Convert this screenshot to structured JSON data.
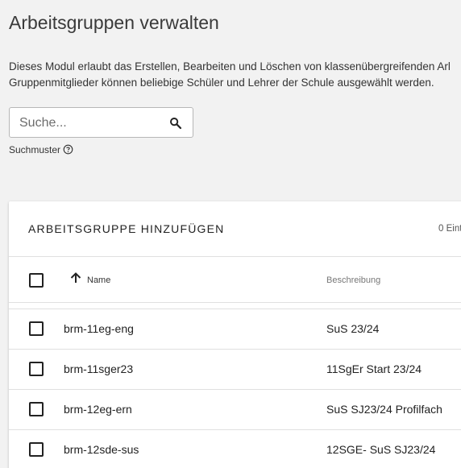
{
  "page": {
    "title": "Arbeitsgruppen verwalten",
    "description_line1": "Dieses Modul erlaubt das Erstellen, Bearbeiten und Löschen von klassenübergreifenden Arl",
    "description_line2": "Gruppenmitglieder können beliebige Schüler und Lehrer der Schule ausgewählt werden."
  },
  "search": {
    "placeholder": "Suche...",
    "value": "",
    "icon": "search-icon",
    "pattern_label": "Suchmuster",
    "help_icon": "help-circle-icon"
  },
  "card": {
    "title": "ARBEITSGRUPPE HINZUFÜGEN",
    "entries_label": "0 Eint"
  },
  "table": {
    "columns": {
      "name": "Name",
      "description": "Beschreibung"
    },
    "sort_icon": "arrow-up-icon",
    "rows": [
      {
        "name": "brm-11eg-eng",
        "description": "SuS 23/24"
      },
      {
        "name": "brm-11sger23",
        "description": "11SgEr Start 23/24"
      },
      {
        "name": "brm-12eg-ern",
        "description": "SuS SJ23/24 Profilfach"
      },
      {
        "name": "brm-12sde-sus",
        "description": "12SGE- SuS SJ23/24"
      }
    ]
  }
}
